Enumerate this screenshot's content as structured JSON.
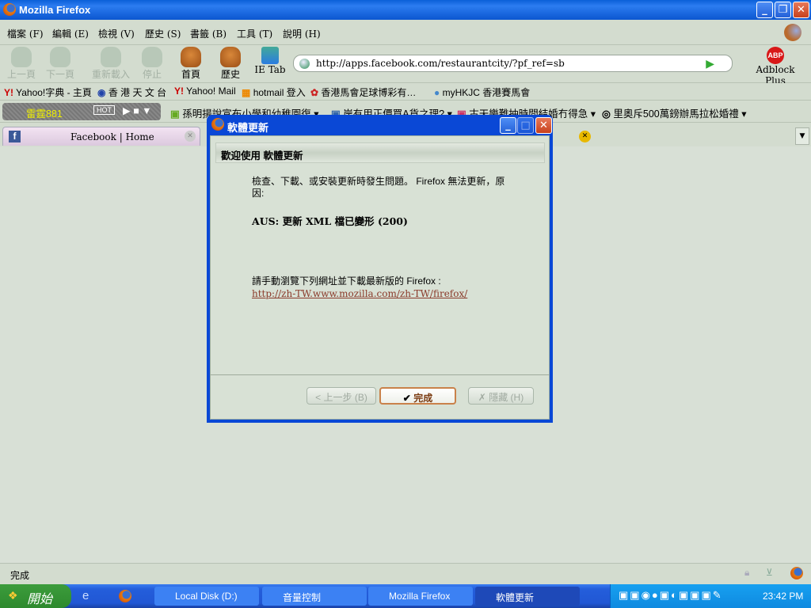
{
  "window": {
    "title": "Mozilla Firefox"
  },
  "menu": [
    "檔案 (F)",
    "編輯 (E)",
    "檢視 (V)",
    "歷史 (S)",
    "書籤 (B)",
    "工具 (T)",
    "說明 (H)"
  ],
  "nav": {
    "back": "上一頁",
    "forward": "下一頁",
    "reload": "重新載入",
    "stop": "停止",
    "home": "首頁",
    "history": "歷史",
    "ietab": "IE Tab",
    "url": "http://apps.facebook.com/restaurantcity/?pf_ref=sb",
    "adblock": "Adblock Plus"
  },
  "bookmarks": [
    "Yahoo!字典 - 主頁",
    "香 港 天 文 台",
    "Yahoo! Mail",
    "hotmail 登入",
    "香港馬會足球博彩有…",
    "myHKJC 香港賽馬會"
  ],
  "toolbar2": {
    "radio": "雷霆881",
    "hot": "HOT",
    "feeds": [
      "孫明揚說宣布小學和幼稚園復",
      "岸有用正價買A貨之理?",
      "古天樂難抽時間結婚冇得急",
      "里奧斥500萬鎊辦馬拉松婚禮"
    ]
  },
  "tabs": [
    {
      "label": "Facebook | Home"
    }
  ],
  "dialog": {
    "title": "軟體更新",
    "header": "歡迎使用 軟體更新",
    "message": "檢查、下載、或安裝更新時發生問題。 Firefox 無法更新，原因:",
    "error": "AUS: 更新 XML 檔已變形 (200)",
    "instruction": "請手動瀏覽下列網址並下載最新版的 Firefox :",
    "link": "http://zh-TW.www.mozilla.com/zh-TW/firefox/",
    "back": "< 上一步 (B)",
    "finish": "完成",
    "hide": "隱藏 (H)"
  },
  "status": "完成",
  "taskbar": {
    "start": "開始",
    "tasks": [
      "Local Disk (D:)",
      "音量控制",
      "Mozilla Firefox",
      "軟體更新"
    ],
    "clock": "23:42 PM"
  }
}
